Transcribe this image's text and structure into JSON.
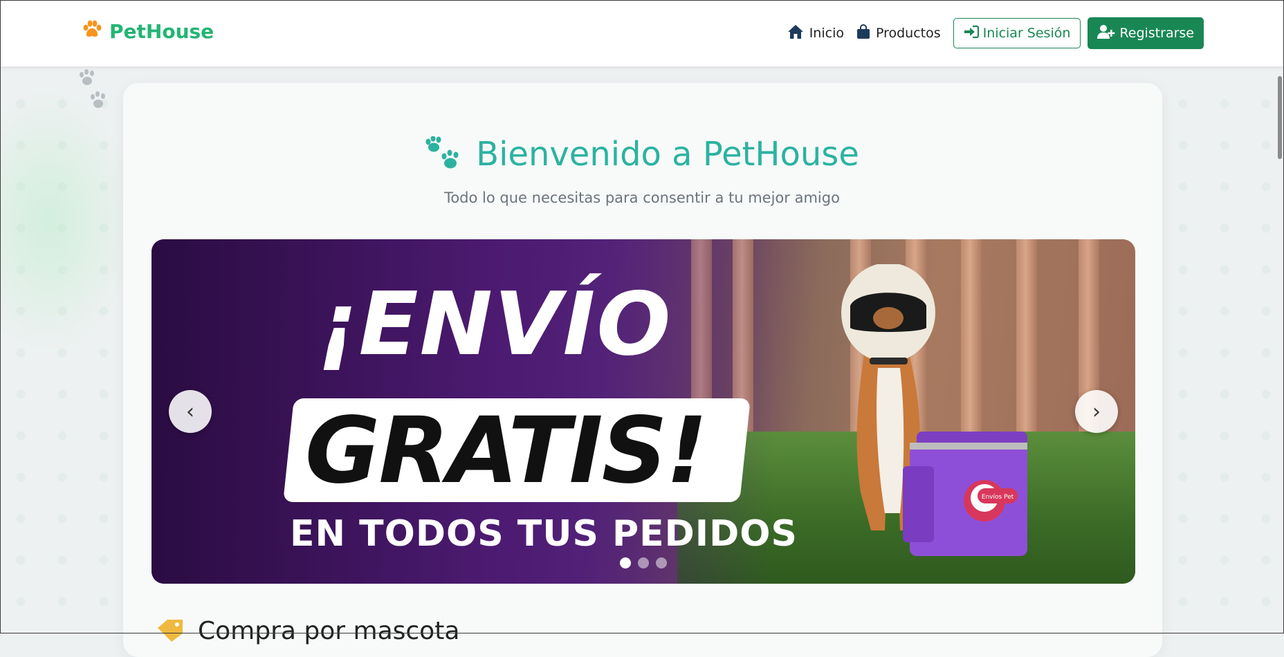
{
  "brand": {
    "name": "PetHouse",
    "icon": "paw-icon",
    "color": "#22b573",
    "icon_color": "#f7941d"
  },
  "nav": {
    "items": [
      {
        "label": "Inicio",
        "icon": "home-icon"
      },
      {
        "label": "Productos",
        "icon": "bag-icon"
      }
    ],
    "login_label": "Iniciar Sesión",
    "register_label": "Registrarse",
    "accent": "#198754"
  },
  "hero": {
    "title": "Bienvenido a PetHouse",
    "subtitle": "Todo lo que necesitas para consentir a tu mejor amigo",
    "title_color": "#2bb3a0"
  },
  "carousel": {
    "slide": {
      "line1": "¡ENVÍO",
      "line2": "GRATIS!",
      "line3": "EN TODOS TUS PEDIDOS",
      "bag_text": "Envíos Pet"
    },
    "slide_count": 3,
    "active_index": 0,
    "prev_label": "‹",
    "next_label": "›"
  },
  "section": {
    "title": "Compra por mascota",
    "icon": "tag-icon"
  }
}
